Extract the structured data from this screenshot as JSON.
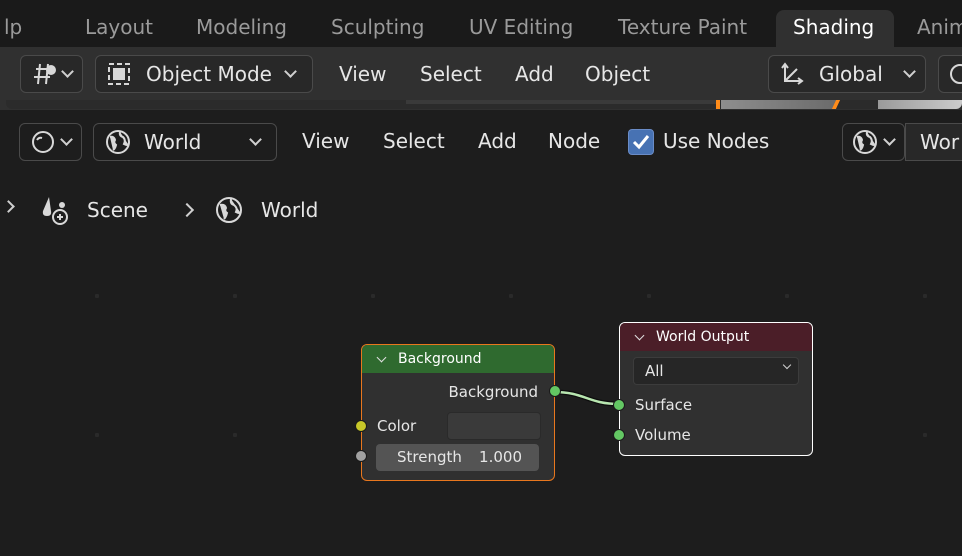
{
  "workspace_tabs": [
    {
      "label": "lp"
    },
    {
      "label": "Layout"
    },
    {
      "label": "Modeling"
    },
    {
      "label": "Sculpting"
    },
    {
      "label": "UV Editing"
    },
    {
      "label": "Texture Paint"
    },
    {
      "label": "Shading",
      "active": true
    },
    {
      "label": "Anim"
    }
  ],
  "viewport_header": {
    "mode_label": "Object Mode",
    "menus": [
      "View",
      "Select",
      "Add",
      "Object"
    ],
    "orientation_label": "Global"
  },
  "node_header": {
    "shader_type_label": "World",
    "menus": [
      "View",
      "Select",
      "Add",
      "Node"
    ],
    "use_nodes_label": "Use Nodes",
    "use_nodes_checked": true,
    "world_slot_label": "Wor"
  },
  "breadcrumb": {
    "scene_label": "Scene",
    "world_label": "World"
  },
  "nodes": {
    "background": {
      "title": "Background",
      "output_label": "Background",
      "color_label": "Color",
      "strength_label": "Strength",
      "strength_value": "1.000",
      "header_color": "#2f6a2f",
      "border_color": "#e8771e"
    },
    "world_output": {
      "title": "World Output",
      "target_value": "All",
      "surface_label": "Surface",
      "volume_label": "Volume",
      "header_color": "#4b1e28",
      "border_color": "#ffffff"
    }
  },
  "colors": {
    "shader_socket": "#63c763",
    "color_socket": "#c7c729",
    "float_socket": "#a1a1a1",
    "checkbox_blue": "#4772b3"
  }
}
